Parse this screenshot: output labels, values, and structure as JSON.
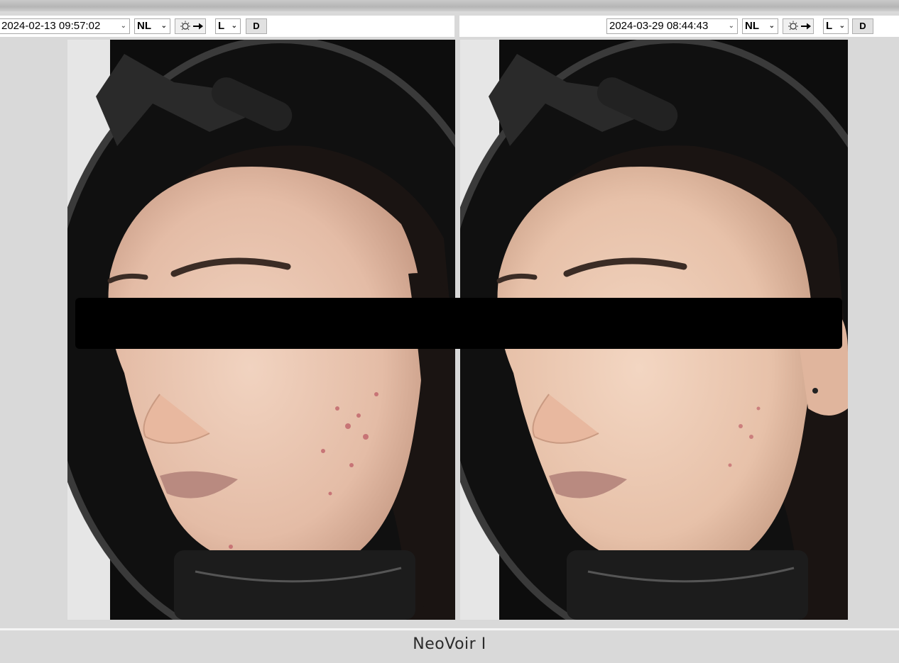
{
  "left_panel": {
    "datetime": "2024-02-13 09:57:02",
    "mode": "NL",
    "light_icon": "lightbulb-arrow-icon",
    "side": "L",
    "d_button": "D"
  },
  "right_panel": {
    "datetime": "2024-03-29 08:44:43",
    "mode": "NL",
    "light_icon": "lightbulb-arrow-icon",
    "side": "L",
    "d_button": "D"
  },
  "footer": {
    "brand": "NeoVoir I"
  },
  "colors": {
    "background": "#d9d9d9",
    "toolbar": "#ffffff",
    "photo_bg": "#0b0b0b",
    "redaction": "#000000"
  }
}
